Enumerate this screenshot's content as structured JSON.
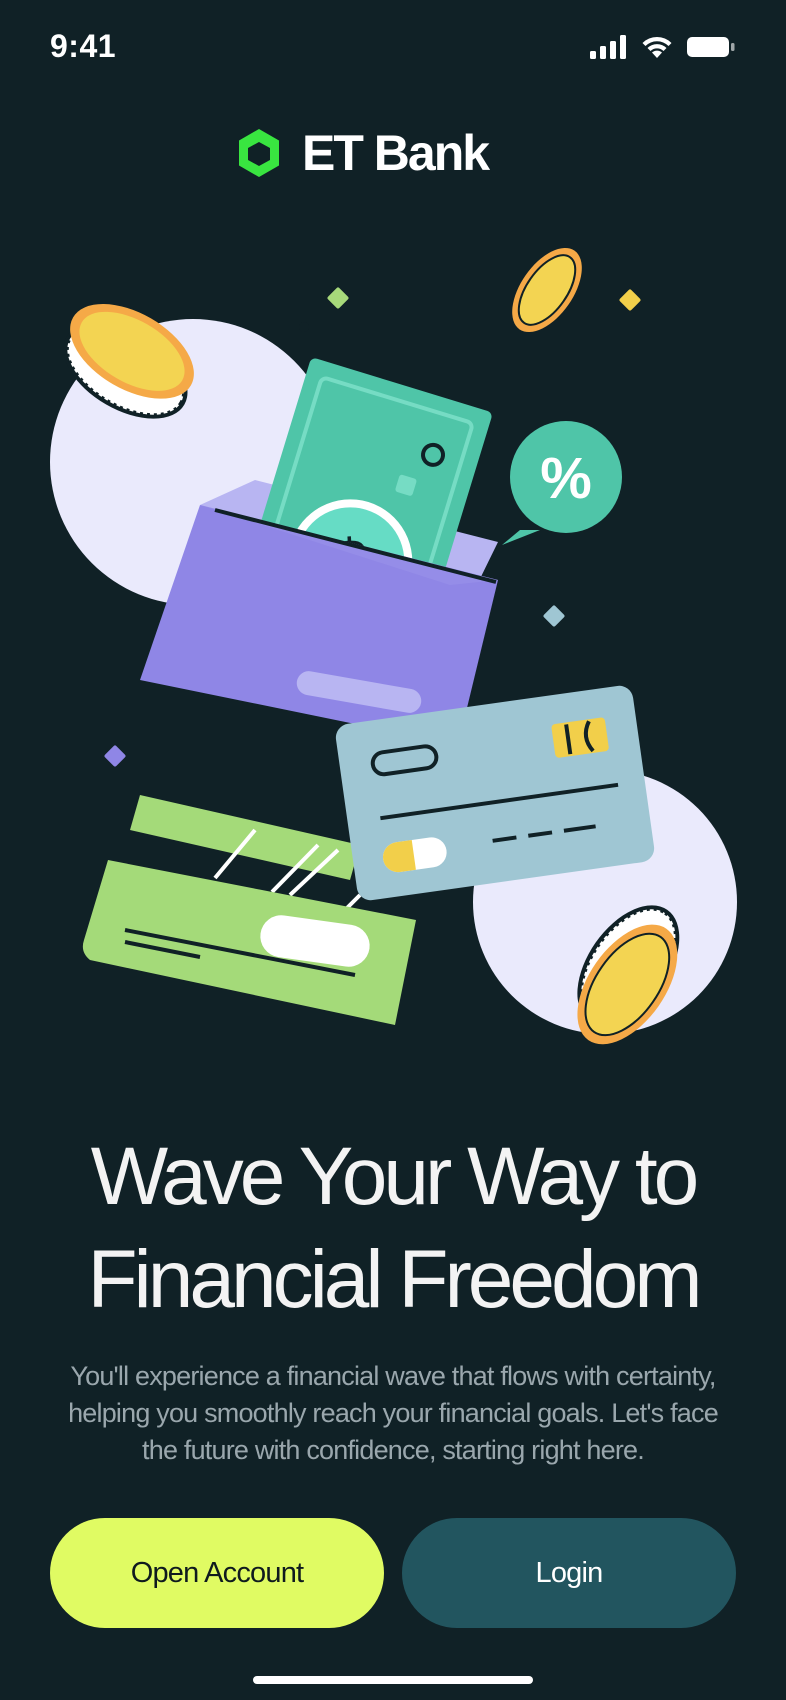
{
  "status_bar": {
    "time": "9:41",
    "icons": [
      "cellular-signal-icon",
      "wifi-icon",
      "battery-icon"
    ]
  },
  "brand": {
    "name": "ET Bank",
    "logo_icon": "hexagon-logo-icon",
    "logo_color": "#39e540"
  },
  "hero": {
    "illustration": "money-envelope-cards-coins-illustration",
    "percent_symbol": "%",
    "dollar_symbol": "$"
  },
  "headline": {
    "line1": "Wave Your Way to",
    "line2": "Financial Freedom"
  },
  "subtext": {
    "line1": "You'll experience a financial wave that flows with certainty,",
    "line2": "helping you smoothly reach your financial goals. Let's face",
    "line3": "the future with confidence, starting right here."
  },
  "actions": {
    "open_account_label": "Open Account",
    "login_label": "Login"
  },
  "colors": {
    "background": "#102126",
    "primary_button": "#e0fb63",
    "secondary_button": "#22555f",
    "text": "#f3f3f3",
    "muted_text": "#9aa7ad"
  }
}
